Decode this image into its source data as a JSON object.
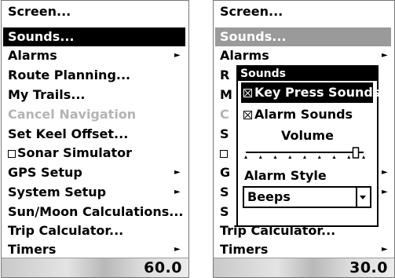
{
  "left_screen": {
    "menu": [
      {
        "label": "Screen..."
      },
      {
        "label": "Sounds..."
      },
      {
        "label": "Alarms"
      },
      {
        "label": "Route Planning..."
      },
      {
        "label": "My Trails..."
      },
      {
        "label": "Cancel Navigation"
      },
      {
        "label": "Set Keel Offset..."
      },
      {
        "label": "Sonar Simulator"
      },
      {
        "label": "GPS Setup"
      },
      {
        "label": "System Setup"
      },
      {
        "label": "Sun/Moon Calculations..."
      },
      {
        "label": "Trip Calculator..."
      },
      {
        "label": "Timers"
      }
    ],
    "depth": "60.0"
  },
  "right_screen": {
    "menu": [
      {
        "label": "Screen..."
      },
      {
        "label": "Sounds..."
      },
      {
        "label": "Alarms"
      },
      {
        "label": "R"
      },
      {
        "label": "M"
      },
      {
        "label": "C"
      },
      {
        "label": "S"
      },
      {
        "label": ""
      },
      {
        "label": "G"
      },
      {
        "label": "S"
      },
      {
        "label": "S"
      },
      {
        "label": "Trip Calculator..."
      },
      {
        "label": "Timers"
      }
    ],
    "depth": "30.0"
  },
  "sounds_dialog": {
    "title": "Sounds",
    "key_press_sounds": {
      "label": "Key Press Sounds",
      "checked": true
    },
    "alarm_sounds": {
      "label": "Alarm Sounds",
      "checked": true
    },
    "volume_label": "Volume",
    "volume_level": 0.93,
    "alarm_style_label": "Alarm Style",
    "alarm_style_value": "Beeps"
  },
  "colors": {
    "selected_bg": "#000000",
    "dim_selected_bg": "#9a9a9a",
    "disabled_text": "#b4b4b4"
  }
}
